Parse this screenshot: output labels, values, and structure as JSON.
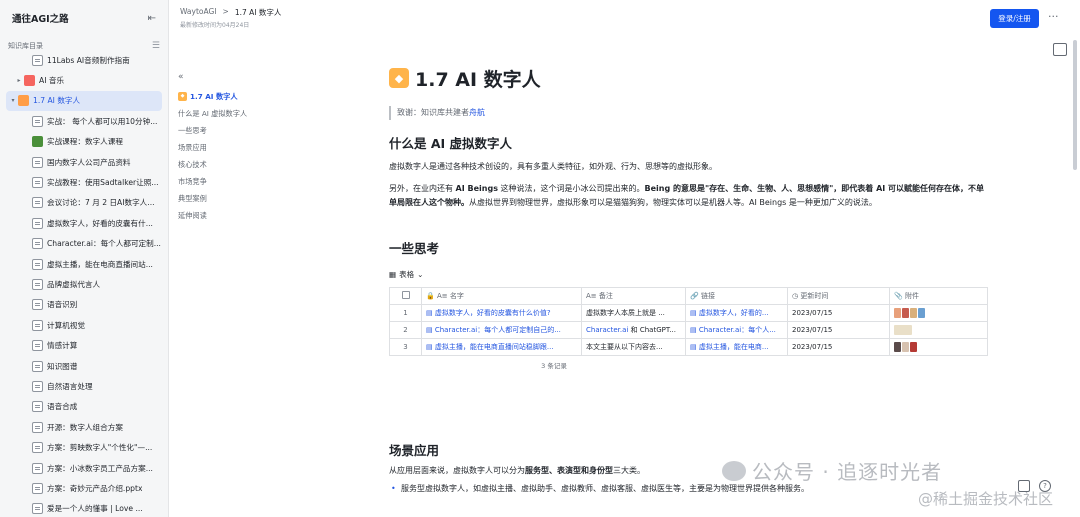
{
  "sidebar": {
    "title": "通往AGI之路",
    "collapse_icon": "collapse-sidebar-icon",
    "subheader": "知识库目录",
    "items": [
      {
        "label": "11Labs AI音频制作指南",
        "icon": "doc",
        "indent": 2
      },
      {
        "label": "AI 音乐",
        "icon": "red",
        "indent": 1,
        "arrow": "▸"
      },
      {
        "label": "1.7 AI 数字人",
        "icon": "orange",
        "indent": 0,
        "arrow": "▾",
        "active": true
      },
      {
        "label": "实战：  每个人都可以用10分钟...",
        "icon": "doc",
        "indent": 2
      },
      {
        "label": "实战课程：数字人课程",
        "icon": "green",
        "indent": 2
      },
      {
        "label": "国内数字人公司产品资料",
        "icon": "doc",
        "indent": 2
      },
      {
        "label": "实战教程：使用Sadtalker让照...",
        "icon": "doc",
        "indent": 2
      },
      {
        "label": "会议讨论：7 月 2 日AI数字人...",
        "icon": "doc",
        "indent": 2
      },
      {
        "label": "虚拟数字人，好看的皮囊有什...",
        "icon": "doc",
        "indent": 2
      },
      {
        "label": "Character.ai：每个人都可定制...",
        "icon": "doc",
        "indent": 2
      },
      {
        "label": "虚拟主播，能在电商直播间站...",
        "icon": "doc",
        "indent": 2
      },
      {
        "label": "品牌虚拟代言人",
        "icon": "doc",
        "indent": 2
      },
      {
        "label": "语音识别",
        "icon": "doc",
        "indent": 2
      },
      {
        "label": "计算机视觉",
        "icon": "doc",
        "indent": 2
      },
      {
        "label": "情感计算",
        "icon": "doc",
        "indent": 2
      },
      {
        "label": "知识图谱",
        "icon": "doc",
        "indent": 2
      },
      {
        "label": "自然语言处理",
        "icon": "doc",
        "indent": 2
      },
      {
        "label": "语音合成",
        "icon": "doc",
        "indent": 2
      },
      {
        "label": "开源：数字人组合方案",
        "icon": "doc",
        "indent": 2
      },
      {
        "label": "方案：剪映数字人\"个性化\"—...",
        "icon": "doc",
        "indent": 2
      },
      {
        "label": "方案：小冰数字员工产品方案...",
        "icon": "doc",
        "indent": 2
      },
      {
        "label": "方案：奇妙元产品介绍.pptx",
        "icon": "doc",
        "indent": 2
      },
      {
        "label": "爱是一个人的懂事 | Love ...",
        "icon": "doc",
        "indent": 2
      }
    ]
  },
  "topbar": {
    "breadcrumb_root": "WaytoAGI",
    "breadcrumb_sep": ">",
    "breadcrumb_current": "1.7 AI 数字人",
    "modified": "最新修改时间为04月24日",
    "login": "登录/注册",
    "more": "···"
  },
  "toc": {
    "back": "«",
    "items": [
      "1.7 AI 数字人",
      "什么是 AI 虚拟数字人",
      "一些思考",
      "场景应用",
      "核心技术",
      "市场竞争",
      "典型案例",
      "延伸阅读"
    ]
  },
  "doc": {
    "title": "1.7 AI 数字人",
    "quote_prefix": "致谢：知识库共建者",
    "quote_link": "舟航",
    "h_what": "什么是 AI 虚拟数字人",
    "p1": "虚拟数字人是通过各种技术创设的，具有多重人类特征，如外观、行为、思想等的虚拟形象。",
    "p2_a": "另外，在业内还有 ",
    "p2_b": "AI Beings",
    "p2_c": " 这种说法，这个词是小冰公司提出来的。",
    "p2_d": "Being 的意思是\"存在、生命、生物、人、思想感情\"，即代表着 AI 可以赋能任何存在体，不单单局限在人这个物种。",
    "p2_e": "从虚拟世界到物理世界，虚拟形象可以是猫猫狗狗，物理实体可以是机器人等。AI Beings 是一种更加广义的说法。",
    "h_think": "一些思考",
    "view_label": "表格",
    "table": {
      "headers": [
        "名字",
        "备注",
        "链接",
        "更新时间",
        "附件"
      ],
      "rows": [
        {
          "n": "1",
          "name": "虚拟数字人，好看的皮囊有什么价值?",
          "note": "虚拟数字人本质上就是 ...",
          "link": "虚拟数字人，好看的...",
          "date": "2023/07/15"
        },
        {
          "n": "2",
          "name": "Character.ai：每个人都可定制自己的...",
          "note_a": "Character.ai",
          "note_b": " 和 ChatGPT...",
          "link": "Character.ai：每个人...",
          "date": "2023/07/15"
        },
        {
          "n": "3",
          "name": "虚拟主播，能在电商直播间站稳脚跟...",
          "note": "本文主要从以下内容去...",
          "link": "虚拟主播，能在电商...",
          "date": "2023/07/15"
        }
      ],
      "records": "3 条记录"
    },
    "h_scene": "场景应用",
    "p_scene_a": "从应用层面来说，虚拟数字人可以分为",
    "p_scene_b": "服务型、表演型和身份型",
    "p_scene_c": "三大类。",
    "bullet1": "服务型虚拟数字人，如虚拟主播、虚拟助手、虚拟教师、虚拟客服、虚拟医生等，主要是为物理世界提供各种服务。"
  },
  "watermark": {
    "line1": "公众号 · 追逐时光者",
    "line2": "@稀土掘金技术社区"
  },
  "colors": {
    "accent": "#1456f0",
    "link": "#2456e0",
    "active_bg": "#dde6f8"
  }
}
